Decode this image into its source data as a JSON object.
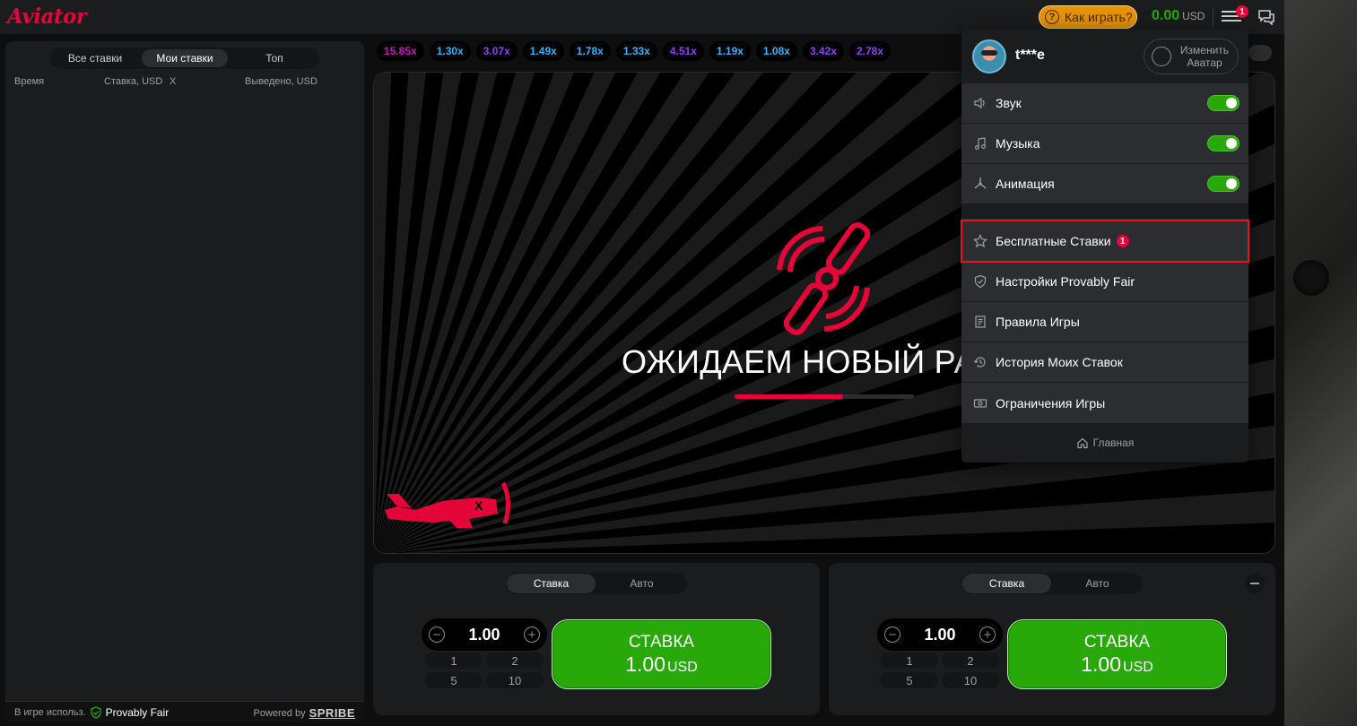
{
  "header": {
    "logo": "Aviator",
    "how_to_play": "Как играть?",
    "balance": "0.00",
    "currency": "USD",
    "menu_badge": "1"
  },
  "left_panel": {
    "tabs": [
      "Все ставки",
      "Мои ставки",
      "Топ"
    ],
    "active_tab": "Мои ставки",
    "columns": {
      "time": "Время",
      "bet": "Ставка, USD",
      "x": "X",
      "cashout": "Выведено, USD"
    },
    "footer": {
      "in_game": "В игре использ.",
      "provably_fair": "Provably Fair",
      "powered_by": "Powered by",
      "brand": "SPRIBE"
    }
  },
  "multipliers": [
    {
      "value": "15.85x",
      "color": "#c017b4"
    },
    {
      "value": "1.30x",
      "color": "#34b4ff"
    },
    {
      "value": "3.07x",
      "color": "#913ef8"
    },
    {
      "value": "1.49x",
      "color": "#34b4ff"
    },
    {
      "value": "1.78x",
      "color": "#34b4ff"
    },
    {
      "value": "1.33x",
      "color": "#34b4ff"
    },
    {
      "value": "4.51x",
      "color": "#913ef8"
    },
    {
      "value": "1.19x",
      "color": "#34b4ff"
    },
    {
      "value": "1.08x",
      "color": "#34b4ff"
    },
    {
      "value": "3.42x",
      "color": "#913ef8"
    },
    {
      "value": "2.78x",
      "color": "#913ef8"
    }
  ],
  "stage": {
    "waiting_text": "ОЖИДАЕМ НОВЫЙ РАУНД",
    "progress": 0.6
  },
  "bet_panels": [
    {
      "tabs": [
        "Ставка",
        "Авто"
      ],
      "active": "Ставка",
      "amount": "1.00",
      "quick": [
        "1",
        "2",
        "5",
        "10"
      ],
      "button_label": "СТАВКА",
      "button_amount": "1.00",
      "currency": "USD"
    },
    {
      "tabs": [
        "Ставка",
        "Авто"
      ],
      "active": "Ставка",
      "amount": "1.00",
      "quick": [
        "1",
        "2",
        "5",
        "10"
      ],
      "button_label": "СТАВКА",
      "button_amount": "1.00",
      "currency": "USD"
    }
  ],
  "menu": {
    "username": "t***e",
    "change_avatar": "Изменить Аватар",
    "toggles": [
      {
        "label": "Звук",
        "icon": "speaker-icon",
        "on": true
      },
      {
        "label": "Музыка",
        "icon": "music-note-icon",
        "on": true
      },
      {
        "label": "Анимация",
        "icon": "propeller-icon",
        "on": true
      }
    ],
    "items": [
      {
        "label": "Бесплатные Ставки",
        "icon": "star-icon",
        "badge": "1"
      },
      {
        "label": "Настройки Provably Fair",
        "icon": "shield-check-icon"
      },
      {
        "label": "Правила Игры",
        "icon": "document-icon"
      },
      {
        "label": "История Моих Ставок",
        "icon": "history-icon"
      },
      {
        "label": "Ограничения Игры",
        "icon": "limits-icon"
      }
    ],
    "home": "Главная"
  },
  "colors": {
    "accent": "#e50539",
    "green": "#28a909",
    "panel": "#1b1c1d"
  }
}
